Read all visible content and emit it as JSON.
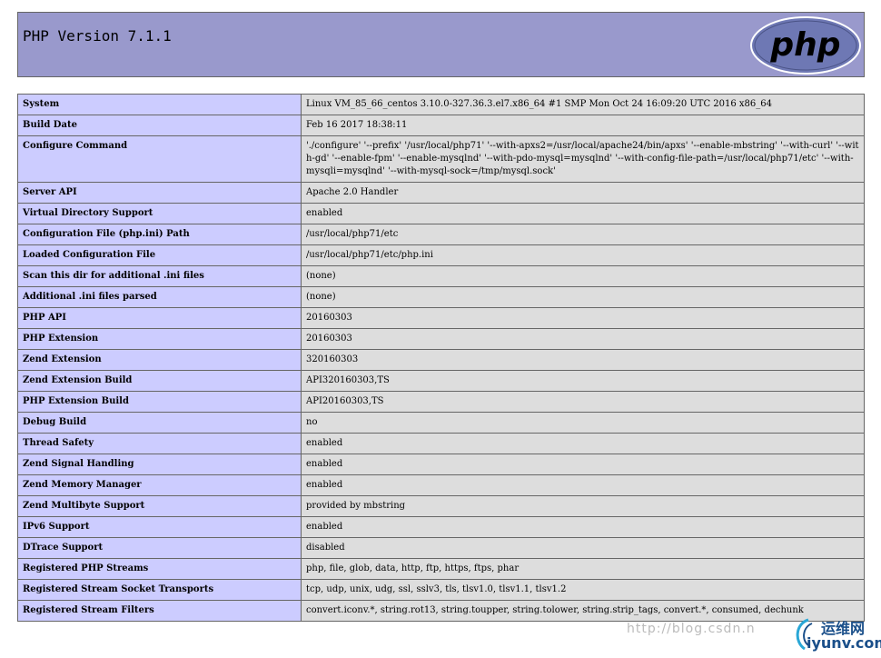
{
  "header": {
    "title": "PHP Version 7.1.1",
    "logo_text": "php"
  },
  "rows": [
    {
      "key": "System",
      "value": "Linux VM_85_66_centos 3.10.0-327.36.3.el7.x86_64 #1 SMP Mon Oct 24 16:09:20 UTC 2016 x86_64"
    },
    {
      "key": "Build Date",
      "value": "Feb 16 2017 18:38:11"
    },
    {
      "key": "Configure Command",
      "value": "'./configure' '--prefix' '/usr/local/php71' '--with-apxs2=/usr/local/apache24/bin/apxs' '--enable-mbstring' '--with-curl' '--with-gd' '--enable-fpm' '--enable-mysqlnd' '--with-pdo-mysql=mysqlnd' '--with-config-file-path=/usr/local/php71/etc' '--with-mysqli=mysqlnd' '--with-mysql-sock=/tmp/mysql.sock'"
    },
    {
      "key": "Server API",
      "value": "Apache 2.0 Handler"
    },
    {
      "key": "Virtual Directory Support",
      "value": "enabled"
    },
    {
      "key": "Configuration File (php.ini) Path",
      "value": "/usr/local/php71/etc"
    },
    {
      "key": "Loaded Configuration File",
      "value": "/usr/local/php71/etc/php.ini"
    },
    {
      "key": "Scan this dir for additional .ini files",
      "value": "(none)"
    },
    {
      "key": "Additional .ini files parsed",
      "value": "(none)"
    },
    {
      "key": "PHP API",
      "value": "20160303"
    },
    {
      "key": "PHP Extension",
      "value": "20160303"
    },
    {
      "key": "Zend Extension",
      "value": "320160303"
    },
    {
      "key": "Zend Extension Build",
      "value": "API320160303,TS"
    },
    {
      "key": "PHP Extension Build",
      "value": "API20160303,TS"
    },
    {
      "key": "Debug Build",
      "value": "no"
    },
    {
      "key": "Thread Safety",
      "value": "enabled"
    },
    {
      "key": "Zend Signal Handling",
      "value": "enabled"
    },
    {
      "key": "Zend Memory Manager",
      "value": "enabled"
    },
    {
      "key": "Zend Multibyte Support",
      "value": "provided by mbstring"
    },
    {
      "key": "IPv6 Support",
      "value": "enabled"
    },
    {
      "key": "DTrace Support",
      "value": "disabled"
    },
    {
      "key": "Registered PHP Streams",
      "value": "php, file, glob, data, http, ftp, https, ftps, phar"
    },
    {
      "key": "Registered Stream Socket Transports",
      "value": "tcp, udp, unix, udg, ssl, sslv3, tls, tlsv1.0, tlsv1.1, tlsv1.2"
    },
    {
      "key": "Registered Stream Filters",
      "value": "convert.iconv.*, string.rot13, string.toupper, string.tolower, string.strip_tags, convert.*, consumed, dechunk"
    }
  ],
  "watermark": {
    "url_text": "http://blog.csdn.n",
    "brand_cn": "运维网",
    "brand_en": "iyunv.com"
  },
  "colors": {
    "header_bg": "#9999cc",
    "key_bg": "#ccccff",
    "value_bg": "#dddddd",
    "border": "#666666",
    "logo_bg": "#6e78b4"
  }
}
